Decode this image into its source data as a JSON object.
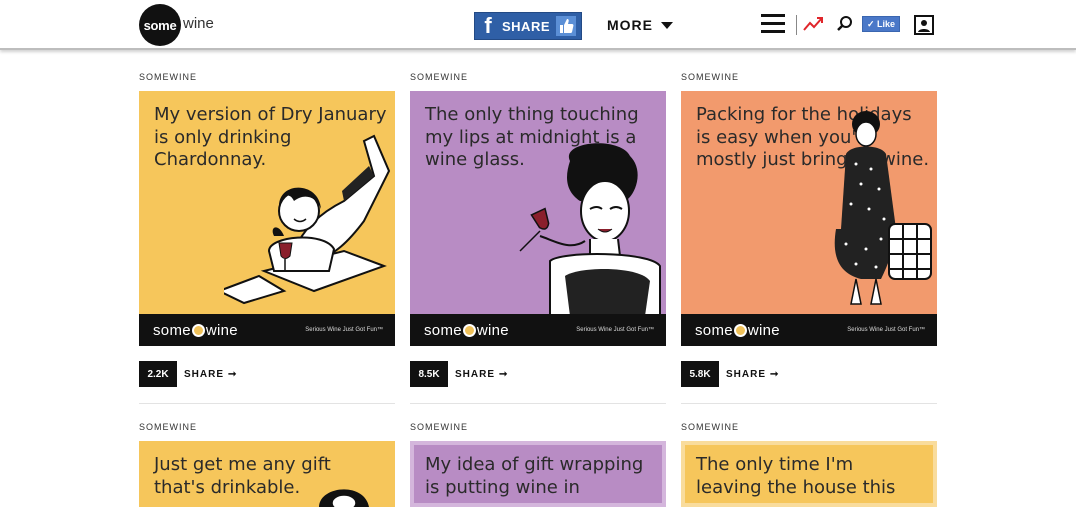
{
  "header": {
    "logo_circle": "some",
    "logo_word": "wine",
    "fb_share_label": "SHARE",
    "more_label": "MORE",
    "like_label": "✓ Like"
  },
  "icons": [
    "hamburger-icon",
    "trending-icon",
    "search-icon",
    "profile-icon",
    "facebook-icon",
    "thumbs-up-icon",
    "chevron-down-icon",
    "arrow-right-icon"
  ],
  "colors": {
    "yellow": "#f6c65b",
    "purple": "#b88cc4",
    "orange": "#f29a6d",
    "fb_blue": "#2f5fa6"
  },
  "cards": [
    {
      "source": "SOMEWINE",
      "text": "My version of Dry January is only drinking Chardonnay.",
      "count": "2.2K",
      "share": "SHARE",
      "footer_brand_left": "some",
      "footer_brand_right": "wine",
      "footer_tag": "Serious Wine Just Got Fun™"
    },
    {
      "source": "SOMEWINE",
      "text": "The only thing touching my lips at midnight is a wine glass.",
      "count": "8.5K",
      "share": "SHARE",
      "footer_brand_left": "some",
      "footer_brand_right": "wine",
      "footer_tag": "Serious Wine Just Got Fun™"
    },
    {
      "source": "SOMEWINE",
      "text": "Packing for the holidays is easy when you're mostly just bringing wine.",
      "count": "5.8K",
      "share": "SHARE",
      "footer_brand_left": "some",
      "footer_brand_right": "wine",
      "footer_tag": "Serious Wine Just Got Fun™"
    },
    {
      "source": "SOMEWINE",
      "text": "Just get me any gift that's drinkable."
    },
    {
      "source": "SOMEWINE",
      "text": "My idea of gift wrapping is putting wine in"
    },
    {
      "source": "SOMEWINE",
      "text": "The only time I'm leaving the house this"
    }
  ]
}
